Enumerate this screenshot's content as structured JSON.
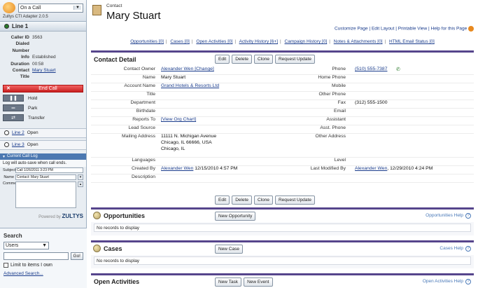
{
  "sidebar": {
    "status": "On a Call",
    "adapter": "Zultys CTI Adapter 2.0.5",
    "line1": {
      "label": "Line 1",
      "caller_id_label": "Caller ID",
      "caller_id": "3563",
      "dialed_label": "Dialed Number",
      "dialed": "",
      "info_label": "Info",
      "info": "Established",
      "duration_label": "Duration",
      "duration": "00:58",
      "contact_label": "Contact",
      "contact": "Mary Stuart",
      "title_label": "Title",
      "title": ""
    },
    "end_call": "End Call",
    "hold": "Hold",
    "park": "Park",
    "transfer": "Transfer",
    "line2": {
      "label": "Line 2",
      "status": "Open"
    },
    "line3": {
      "label": "Line 3",
      "status": "Open"
    },
    "log": {
      "header": "Current Call Log",
      "note": "Log will auto-save when call ends.",
      "subject_label": "Subject",
      "subject": "Call 1/26/2011 3:23 PM",
      "name_label": "Name",
      "name": "Contact: Mary Stuart",
      "comments_label": "Comments"
    },
    "powered_by": "Powered by",
    "brand": "ZULTYS"
  },
  "search": {
    "title": "Search",
    "scope": "Users",
    "go": "Go!",
    "limit_label": "Limit to items I own",
    "advanced": "Advanced Search..."
  },
  "header": {
    "type": "Contact",
    "name": "Mary Stuart",
    "links": "Customize Page | Edit Layout | Printable View | Help for this Page"
  },
  "related": [
    "Opportunities [0]",
    "Cases [0]",
    "Open Activities [0]",
    "Activity History [6+]",
    "Campaign History [0]",
    "Notes & Attachments [0]",
    "HTML Email Status [0]"
  ],
  "detail": {
    "title": "Contact Detail",
    "buttons": {
      "edit": "Edit",
      "delete": "Delete",
      "clone": "Clone",
      "request_update": "Request Update"
    },
    "fields": {
      "contact_owner_label": "Contact Owner",
      "contact_owner": "Alexander Wen [Change]",
      "name_label": "Name",
      "name": "Mary Stuart",
      "account_name_label": "Account Name",
      "account_name": "Grand Hotels & Resorts Ltd",
      "title_label": "Title",
      "department_label": "Department",
      "birthdate_label": "Birthdate",
      "reports_to_label": "Reports To",
      "reports_to": "[View Org Chart]",
      "lead_source_label": "Lead Source",
      "mailing_address_label": "Mailing Address",
      "mailing_address_1": "11111 N. Michigan Avenue",
      "mailing_address_2": "Chicago, IL 66666, USA",
      "mailing_address_3": "Chicago, IL",
      "languages_label": "Languages",
      "created_by_label": "Created By",
      "created_by_user": "Alexander Wen",
      "created_by_date": "12/15/2010 4:57 PM",
      "description_label": "Description",
      "phone_label": "Phone",
      "phone": "(510) 555-7387",
      "home_phone_label": "Home Phone",
      "mobile_label": "Mobile",
      "other_phone_label": "Other Phone",
      "fax_label": "Fax",
      "fax": "(312) 555-1500",
      "email_label": "Email",
      "assistant_label": "Assistant",
      "asst_phone_label": "Asst. Phone",
      "other_address_label": "Other Address",
      "level_label": "Level",
      "last_modified_label": "Last Modified By",
      "last_modified_user": "Alexander Wen",
      "last_modified_date": ", 12/29/2010 4:24 PM"
    }
  },
  "opportunities": {
    "title": "Opportunities",
    "button": "New Opportunity",
    "help": "Opportunities Help",
    "empty": "No records to display"
  },
  "cases": {
    "title": "Cases",
    "button": "New Case",
    "help": "Cases Help",
    "empty": "No records to display"
  },
  "activities": {
    "title": "Open Activities",
    "button_task": "New Task",
    "button_event": "New Event",
    "help": "Open Activities Help"
  }
}
